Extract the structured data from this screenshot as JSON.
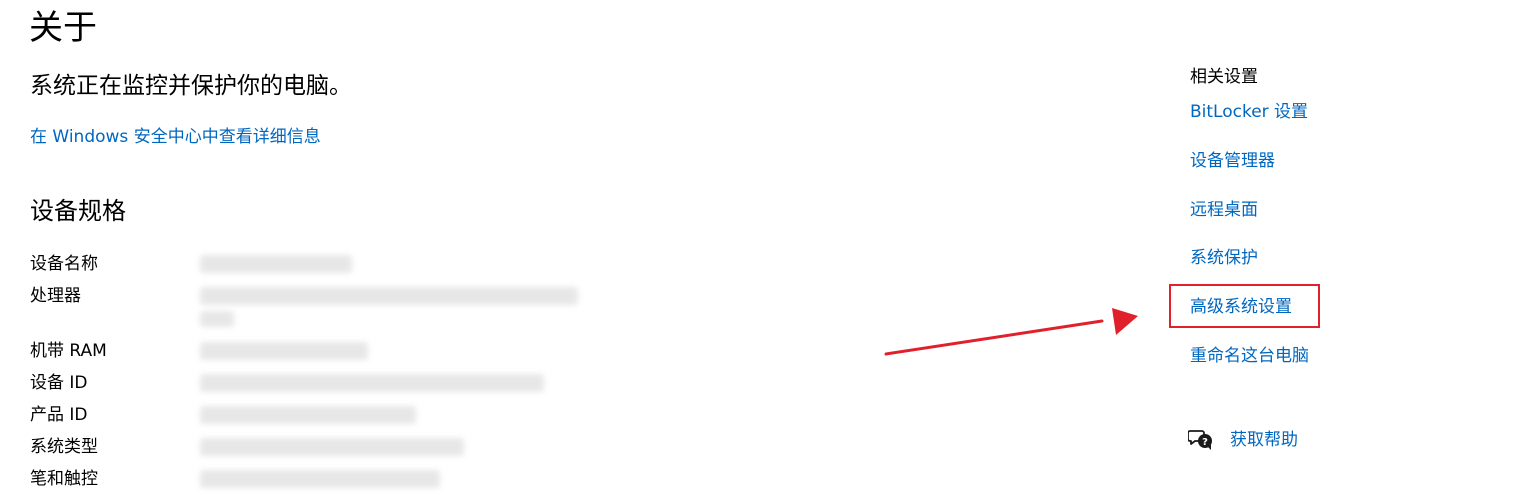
{
  "page": {
    "title": "关于",
    "status": "系统正在监控并保护你的电脑。",
    "security_link": "在 Windows 安全中心中查看详细信息"
  },
  "specs": {
    "title": "设备规格",
    "rows": [
      {
        "label": "设备名称"
      },
      {
        "label": "处理器"
      },
      {
        "label": "机带 RAM"
      },
      {
        "label": "设备 ID"
      },
      {
        "label": "产品 ID"
      },
      {
        "label": "系统类型"
      },
      {
        "label": "笔和触控"
      }
    ]
  },
  "related": {
    "title": "相关设置",
    "links": [
      "BitLocker 设置",
      "设备管理器",
      "远程桌面",
      "系统保护",
      "高级系统设置",
      "重命名这台电脑"
    ],
    "highlighted_index": 4
  },
  "help": {
    "label": "获取帮助",
    "icon": "chat-help-icon"
  },
  "colors": {
    "link": "#0067c0",
    "highlight": "#e0202a"
  }
}
